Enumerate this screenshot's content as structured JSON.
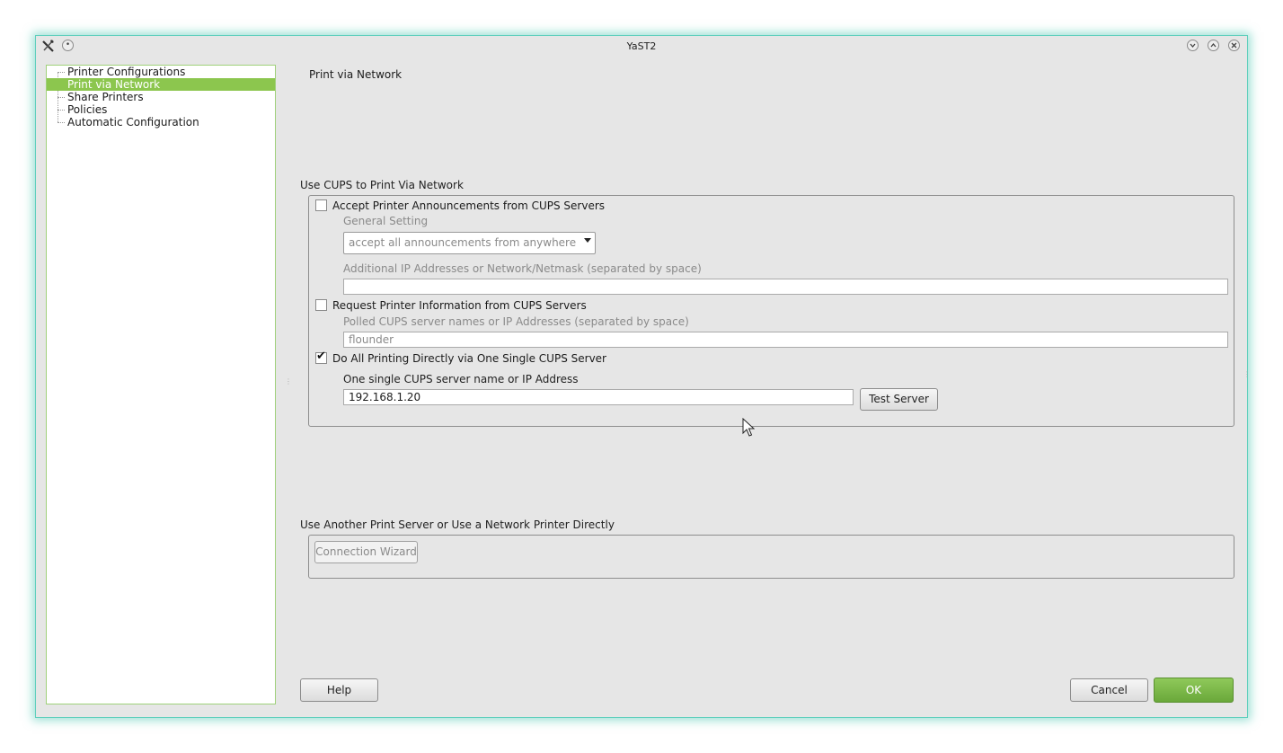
{
  "window": {
    "title": "YaST2"
  },
  "tree": {
    "items": [
      {
        "label": "Printer Configurations",
        "selected": false
      },
      {
        "label": "Print via Network",
        "selected": true
      },
      {
        "label": "Share Printers",
        "selected": false
      },
      {
        "label": "Policies",
        "selected": false
      },
      {
        "label": "Automatic Configuration",
        "selected": false
      }
    ]
  },
  "main": {
    "heading": "Print via Network",
    "cups_section": {
      "title": "Use CUPS to Print Via Network",
      "accept_checkbox": {
        "label": "Accept Printer Announcements from CUPS Servers",
        "checked": false
      },
      "general_setting_label": "General Setting",
      "general_setting_value": "accept all announcements from anywhere",
      "additional_ip_label": "Additional IP Addresses or Network/Netmask (separated by space)",
      "additional_ip_value": "",
      "request_checkbox": {
        "label": "Request Printer Information from CUPS Servers",
        "checked": false
      },
      "polled_label": "Polled CUPS server names or IP Addresses (separated by space)",
      "polled_value": "flounder",
      "direct_checkbox": {
        "label": "Do All Printing Directly via One Single CUPS Server",
        "checked": true
      },
      "single_server_label": "One single CUPS server name or IP Address",
      "single_server_value": "192.168.1.20",
      "test_server_label": "Test Server"
    },
    "other_section": {
      "title": "Use Another Print Server or Use a Network Printer Directly",
      "wizard_label": "Connection Wizard"
    }
  },
  "footer": {
    "help_label": "Help",
    "cancel_label": "Cancel",
    "ok_label": "OK"
  },
  "colors": {
    "accent": "#8cc64e",
    "ok_button": "#7ab84a",
    "window_glow": "#5fcfbd",
    "background": "#e6e6e6"
  },
  "icons": [
    "yast-app-icon",
    "pin-icon",
    "minimize-icon",
    "maximize-icon",
    "close-icon",
    "check-icon",
    "dropdown-arrow-icon",
    "mouse-cursor-icon"
  ]
}
